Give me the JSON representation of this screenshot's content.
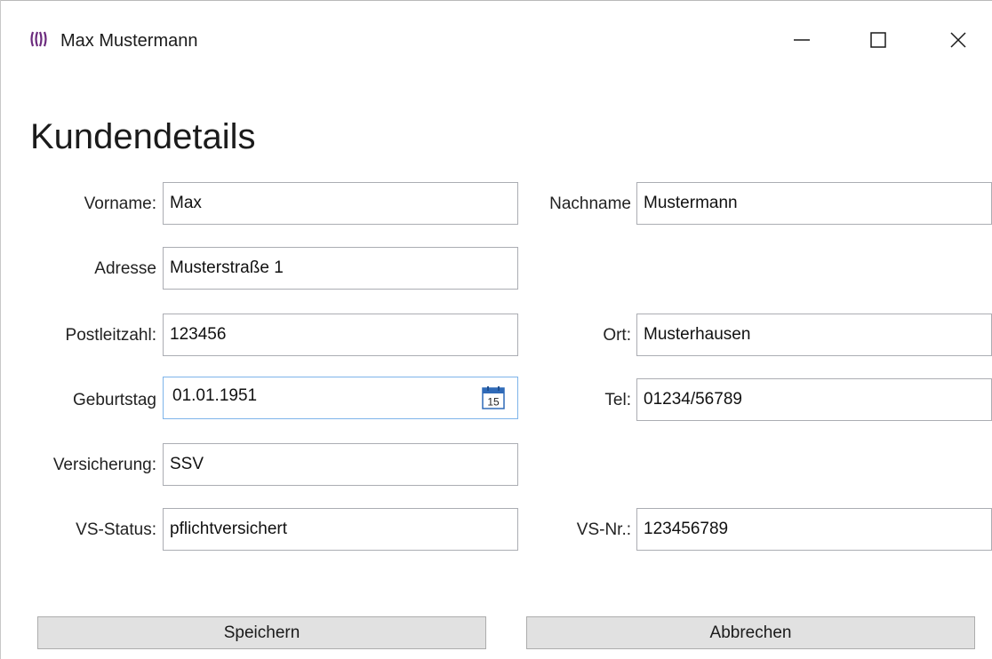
{
  "window": {
    "title": "Max Mustermann",
    "icons": {
      "app": "app-logo-icon",
      "minimize": "minimize-icon",
      "maximize": "maximize-icon",
      "close": "close-icon"
    }
  },
  "heading": "Kundendetails",
  "form": {
    "vorname": {
      "label": "Vorname:",
      "value": "Max"
    },
    "nachname": {
      "label": "Nachname",
      "value": "Mustermann"
    },
    "adresse": {
      "label": "Adresse",
      "value": "Musterstraße 1"
    },
    "plz": {
      "label": "Postleitzahl:",
      "value": "123456"
    },
    "ort": {
      "label": "Ort:",
      "value": "Musterhausen"
    },
    "geburtstag": {
      "label": "Geburtstag",
      "value": "01.01.1951",
      "calendar_day": "15"
    },
    "tel": {
      "label": "Tel:",
      "value": "01234/56789"
    },
    "versicherung": {
      "label": "Versicherung:",
      "value": "SSV"
    },
    "vs_status": {
      "label": "VS-Status:",
      "value": "pflichtversichert"
    },
    "vs_nr": {
      "label": "VS-Nr.:",
      "value": "123456789"
    }
  },
  "buttons": {
    "save": "Speichern",
    "cancel": "Abbrechen"
  },
  "colors": {
    "app_icon": "#6b2a7d",
    "date_border": "#7eb4ea",
    "button_bg": "#e1e1e1",
    "calendar": "#2f6ab8"
  }
}
